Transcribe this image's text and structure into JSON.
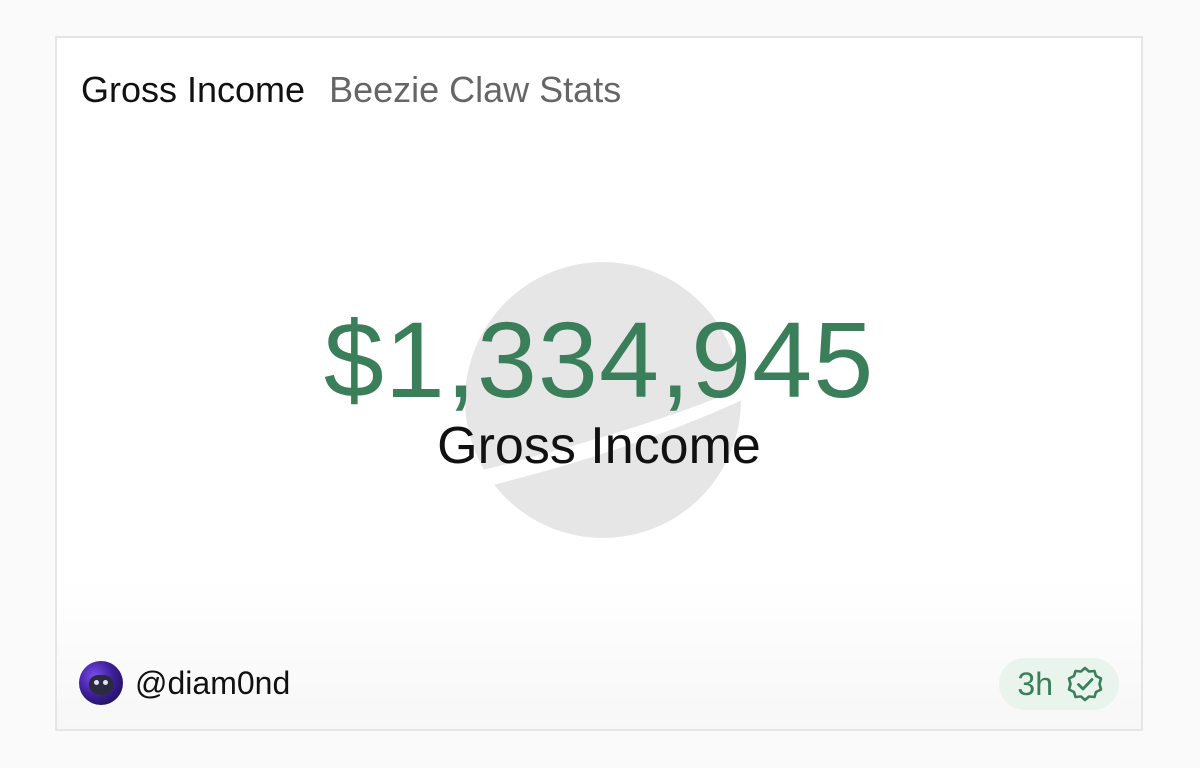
{
  "header": {
    "title": "Gross Income",
    "subtitle": "Beezie Claw Stats"
  },
  "metric": {
    "value": "$1,334,945",
    "label": "Gross Income"
  },
  "footer": {
    "handle": "@diam0nd",
    "time": "3h"
  },
  "icons": {
    "watermark": "circle-logo-watermark",
    "avatar": "user-avatar",
    "verified": "verified-check-icon"
  },
  "colors": {
    "accent_green": "#3a7f59",
    "badge_bg": "#e8f4ec",
    "watermark_gray": "#e6e6e6"
  }
}
